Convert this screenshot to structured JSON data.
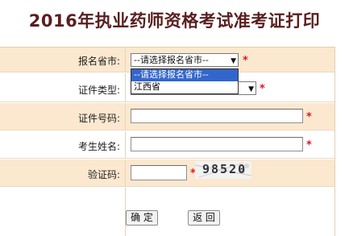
{
  "page": {
    "title": "2016年执业药师资格考试准考证打印"
  },
  "form": {
    "province": {
      "label": "报名省市:",
      "selected": "--请选择报名省市--",
      "options": [
        "--请选择报名省市--",
        "江西省"
      ],
      "required_mark": "*"
    },
    "id_type": {
      "label": "证件类型:",
      "required_mark": "*"
    },
    "id_number": {
      "label": "证件号码:",
      "value": "",
      "required_mark": "*"
    },
    "name": {
      "label": "考生姓名:",
      "value": "",
      "required_mark": "*"
    },
    "captcha": {
      "label": "验证码:",
      "value": "",
      "required_mark": "*",
      "image_text": "98520"
    }
  },
  "buttons": {
    "confirm": "确 定",
    "back": "返 回"
  },
  "colors": {
    "title": "#5a1f1f",
    "row_tan": "#fbe8cf",
    "required": "#e8141b",
    "dropdown_highlight": "#3366cc"
  }
}
